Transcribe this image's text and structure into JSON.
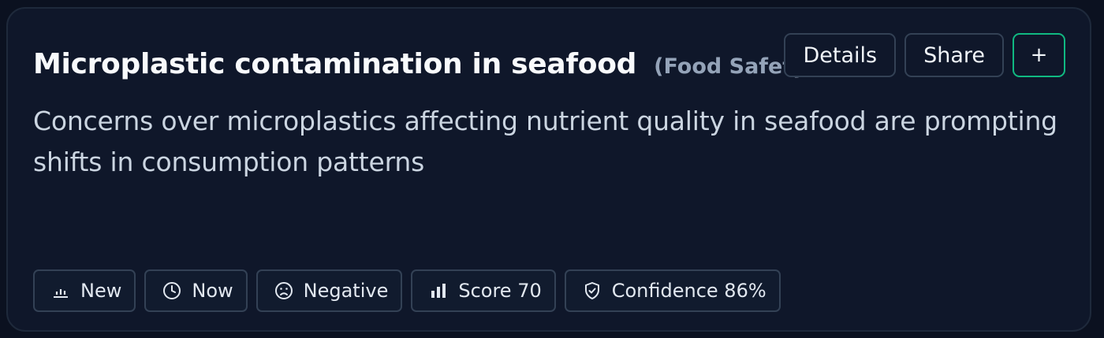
{
  "card": {
    "title": "Microplastic contamination in seafood",
    "category": "(Food Safety)",
    "description": "Concerns over microplastics affecting nutrient quality in seafood are prompting shifts in consumption patterns"
  },
  "actions": {
    "details_label": "Details",
    "share_label": "Share",
    "add_label": "+"
  },
  "tags": [
    {
      "icon": "bar-chart-low-icon",
      "label": "New"
    },
    {
      "icon": "clock-icon",
      "label": "Now"
    },
    {
      "icon": "frown-face-icon",
      "label": "Negative"
    },
    {
      "icon": "bar-chart-icon",
      "label": "Score 70"
    },
    {
      "icon": "shield-check-icon",
      "label": "Confidence 86%"
    }
  ],
  "colors": {
    "background": "#0b1120",
    "card": "#0f172a",
    "border": "#334155",
    "accent": "#10b981"
  }
}
